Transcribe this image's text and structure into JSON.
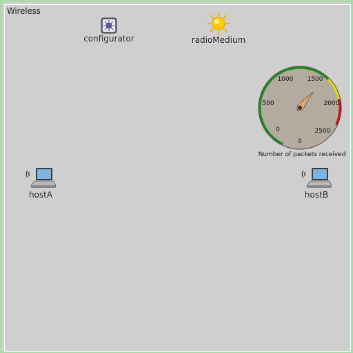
{
  "network": {
    "title": "Wireless"
  },
  "nodes": {
    "configurator": {
      "label": "configurator",
      "icon": "configurator-chip-icon"
    },
    "radioMedium": {
      "label": "radioMedium",
      "icon": "sun-icon"
    },
    "hostA": {
      "label": "hostA",
      "icon": "wireless-laptop-icon"
    },
    "hostB": {
      "label": "hostB",
      "icon": "wireless-laptop-icon"
    }
  },
  "gauge": {
    "label": "Number of packets received",
    "value": 0,
    "min": 0,
    "max": 2500,
    "ticks": [
      "0",
      "500",
      "1000",
      "1500",
      "2000",
      "2500"
    ],
    "zones": {
      "green": "#1a8a1a",
      "yellow": "#e8e000",
      "red": "#d01010"
    },
    "face_color": "#b3aaa0",
    "needle_color": "#e0a870"
  },
  "colors": {
    "canvas": "#cfcfcf",
    "border": "#a8dca8"
  }
}
